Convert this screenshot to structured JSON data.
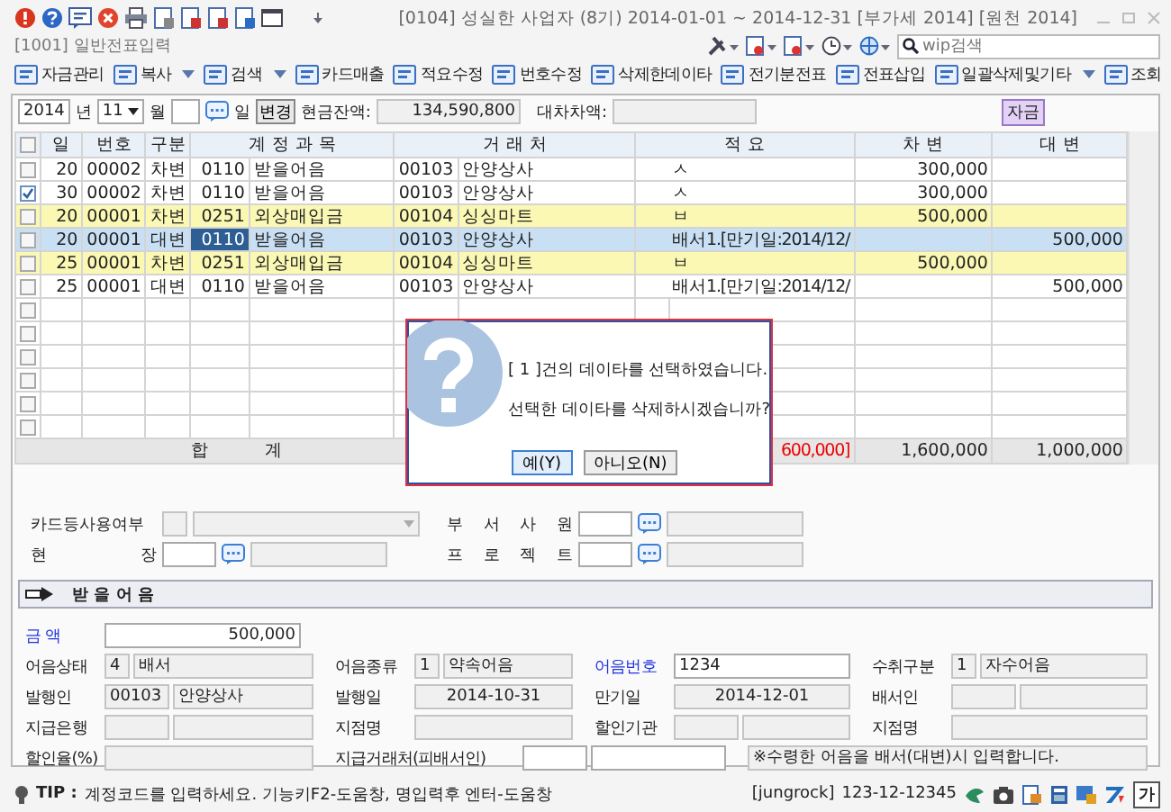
{
  "window": {
    "title": "[0104] 성실한 사업자 (8기) 2014-01-01 ~ 2014-12-31 [부가세 2014] [원천 2014]",
    "breadcrumb": "[1001] 일반전표입력",
    "search": {
      "placeholder": "wip검색"
    }
  },
  "toolbar": [
    {
      "label": "자금관리",
      "has_menu": false
    },
    {
      "label": "복사",
      "has_menu": true
    },
    {
      "label": "검색",
      "has_menu": true
    },
    {
      "label": "카드매출",
      "has_menu": false
    },
    {
      "label": "적요수정",
      "has_menu": false
    },
    {
      "label": "번호수정",
      "has_menu": false
    },
    {
      "label": "삭제한데이타",
      "has_menu": false
    },
    {
      "label": "전기분전표",
      "has_menu": false
    },
    {
      "label": "전표삽입",
      "has_menu": false
    },
    {
      "label": "일괄삭제및기타",
      "has_menu": true
    },
    {
      "label": "조회",
      "has_menu": false
    }
  ],
  "filter": {
    "year": "2014",
    "year_unit": "년",
    "month": "11",
    "month_unit": "월",
    "day_unit": "일",
    "change_button": "변경",
    "cash_label": "현금잔액:",
    "cash_value": "134,590,800",
    "diff_label": "대차차액:",
    "fund_tag": "자금"
  },
  "table": {
    "columns": [
      "일",
      "번호",
      "구분",
      "계 정 과 목",
      "거 래 처",
      "적 요",
      "차 변",
      "대 변"
    ],
    "all_checked": false,
    "rows": [
      {
        "day": "20",
        "no": "00002",
        "type": "차변",
        "code": "0110",
        "account": "받을어음",
        "partner_code": "00103",
        "partner": "안양상사",
        "memo": "ㅅ",
        "debit": "300,000",
        "checked": false,
        "selected": false,
        "highlighted": false
      },
      {
        "day": "30",
        "no": "00002",
        "type": "차변",
        "code": "0110",
        "account": "받을어음",
        "partner_code": "00103",
        "partner": "안양상사",
        "memo": "ㅅ",
        "debit": "300,000",
        "checked": true,
        "selected": false,
        "highlighted": false
      },
      {
        "day": "20",
        "no": "00001",
        "type": "차변",
        "code": "0251",
        "account": "외상매입금",
        "partner_code": "00104",
        "partner": "싱싱마트",
        "memo": "ㅂ",
        "debit": "500,000",
        "checked": false,
        "selected": false,
        "highlighted": true
      },
      {
        "day": "20",
        "no": "00001",
        "type": "대변",
        "code": "0110",
        "account": "받을어음",
        "partner_code": "00103",
        "partner": "안양상사",
        "memo": "배서1.[만기일:2014/12/",
        "credit": "500,000",
        "checked": false,
        "selected": true,
        "highlighted": false
      },
      {
        "day": "25",
        "no": "00001",
        "type": "차변",
        "code": "0251",
        "account": "외상매입금",
        "partner_code": "00104",
        "partner": "싱싱마트",
        "memo": "ㅂ",
        "debit": "500,000",
        "checked": false,
        "selected": false,
        "highlighted": true
      },
      {
        "day": "25",
        "no": "00001",
        "type": "대변",
        "code": "0110",
        "account": "받을어음",
        "partner_code": "00103",
        "partner": "안양상사",
        "memo": "배서1.[만기일:2014/12/",
        "credit": "500,000",
        "checked": false,
        "selected": false,
        "highlighted": false
      }
    ],
    "empty_rows": [
      {
        "checked": false
      },
      {
        "checked": false
      },
      {
        "checked": false
      },
      {
        "checked": false
      },
      {
        "checked": false
      },
      {
        "checked": false
      }
    ],
    "total": {
      "label": "합 계",
      "difference": "600,000]",
      "debit": "1,600,000",
      "credit": "1,000,000"
    }
  },
  "dialog": {
    "lines": [
      "[ 1 ]건의 데이타를 선택하였습니다.",
      "선택한 데이타를 삭제하시겠습니까?"
    ],
    "buttons": [
      {
        "label": "예(Y)",
        "selected": true
      },
      {
        "label": "아니오(N)",
        "selected": false
      }
    ]
  },
  "extra": [
    {
      "label": "카드등사용여부",
      "lookup": false
    },
    {
      "label": "부 서 사 원",
      "lookup": true
    },
    {
      "label": "현 장",
      "lookup": true
    },
    {
      "label": "프 로 젝 트",
      "lookup": true
    }
  ],
  "section": {
    "title": "받 을 어 음"
  },
  "form": [
    [
      {
        "label": "금 액",
        "required": true,
        "fields": [
          {
            "kind": "amount",
            "value": "500,000",
            "editable": true
          }
        ]
      }
    ],
    [
      {
        "label": "어음상태",
        "required": false,
        "fields": [
          {
            "kind": "code",
            "value": "4",
            "editable": false
          },
          {
            "kind": "name",
            "value": "배서",
            "editable": false
          }
        ]
      },
      {
        "label": "어음종류",
        "required": false,
        "fields": [
          {
            "kind": "code",
            "value": "1",
            "editable": false
          },
          {
            "kind": "name",
            "value": "약속어음",
            "editable": false
          }
        ]
      },
      {
        "label": "어음번호",
        "required": true,
        "fields": [
          {
            "kind": "name",
            "value": "1234",
            "editable": true
          }
        ]
      },
      {
        "label": "수취구분",
        "required": false,
        "fields": [
          {
            "kind": "code",
            "value": "1",
            "editable": false
          },
          {
            "kind": "name",
            "value": "자수어음",
            "editable": false
          }
        ]
      }
    ],
    [
      {
        "label": "발행인",
        "required": false,
        "fields": [
          {
            "kind": "box",
            "value": "00103",
            "editable": false
          },
          {
            "kind": "name",
            "value": "안양상사",
            "editable": false
          }
        ]
      },
      {
        "label": "발행일",
        "required": false,
        "fields": [
          {
            "kind": "date",
            "value": "2014-10-31",
            "editable": false
          }
        ]
      },
      {
        "label": "만기일",
        "required": false,
        "fields": [
          {
            "kind": "date",
            "value": "2014-12-01",
            "editable": false
          }
        ]
      },
      {
        "label": "배서인",
        "required": false,
        "fields": [
          {
            "kind": "box",
            "editable": false
          },
          {
            "kind": "name",
            "editable": false
          }
        ]
      }
    ],
    [
      {
        "label": "지급은행",
        "required": false,
        "fields": [
          {
            "kind": "box",
            "editable": false
          },
          {
            "kind": "name",
            "editable": false
          }
        ]
      },
      {
        "label": "지점명",
        "required": false,
        "fields": [
          {
            "kind": "name",
            "editable": false
          }
        ]
      },
      {
        "label": "할인기관",
        "required": false,
        "fields": [
          {
            "kind": "box",
            "editable": false
          },
          {
            "kind": "name",
            "editable": false
          }
        ]
      },
      {
        "label": "지점명",
        "required": false,
        "fields": [
          {
            "kind": "name",
            "editable": false
          }
        ]
      }
    ]
  ],
  "last_row": {
    "rate": {
      "label": "할인율(%)",
      "required": false,
      "fields": [
        {
          "kind": "name",
          "editable": false
        }
      ]
    },
    "payee": {
      "label": "지급거래처(피배서인)",
      "required": false,
      "fields": [
        {
          "kind": "box",
          "editable": true
        },
        {
          "kind": "name",
          "editable": true
        }
      ]
    },
    "note": "※수령한 어음을 배서(대변)시 입력합니다."
  },
  "status_bar": {
    "tip_label": "TIP :",
    "tip": "계정코드를 입력하세요. 기능키F2-도움창, 명입력후 엔터-도움창",
    "user": "[jungrock]",
    "biz_no": "123-12-12345",
    "ime": "가"
  }
}
